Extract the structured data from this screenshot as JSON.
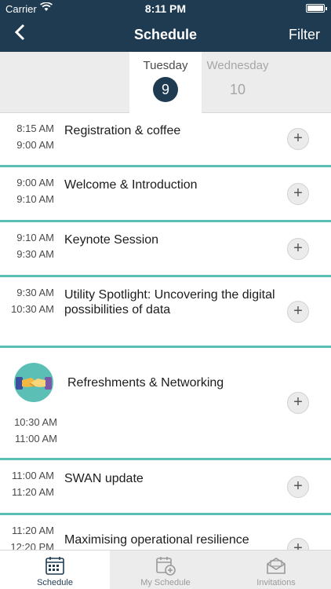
{
  "status_bar": {
    "carrier": "Carrier",
    "time": "8:11 PM"
  },
  "header": {
    "title": "Schedule",
    "filter_label": "Filter"
  },
  "days": [
    {
      "name": "Tuesday",
      "number": "9"
    },
    {
      "name": "Wednesday",
      "number": "10"
    }
  ],
  "events": [
    {
      "start": "8:15 AM",
      "end": "9:00 AM",
      "title": "Registration & coffee",
      "add": "+"
    },
    {
      "start": "9:00 AM",
      "end": "9:10 AM",
      "title": "Welcome & Introduction",
      "add": "+"
    },
    {
      "start": "9:10 AM",
      "end": "9:30 AM",
      "title": "Keynote Session",
      "add": "+"
    },
    {
      "start": "9:30 AM",
      "end": "10:30 AM",
      "title": "Utility Spotlight: Uncovering the digital possibilities of data",
      "add": "+"
    },
    {
      "start": "10:30 AM",
      "end": "11:00 AM",
      "title": "Refreshments & Networking",
      "add": "+",
      "icon": "handshake-icon"
    },
    {
      "start": "11:00 AM",
      "end": "11:20 AM",
      "title": "SWAN update",
      "add": "+"
    },
    {
      "start": "11:20 AM",
      "end": "12:20 PM",
      "title": "Maximising operational resilience",
      "add": "+"
    }
  ],
  "tabs": [
    {
      "label": "Schedule",
      "icon": "calendar-icon"
    },
    {
      "label": "My Schedule",
      "icon": "calendar-add-icon"
    },
    {
      "label": "Invitations",
      "icon": "envelope-icon"
    }
  ],
  "colors": {
    "header": "#1f3b52",
    "separator": "#5bbfb5",
    "tabbar": "#ececec"
  }
}
